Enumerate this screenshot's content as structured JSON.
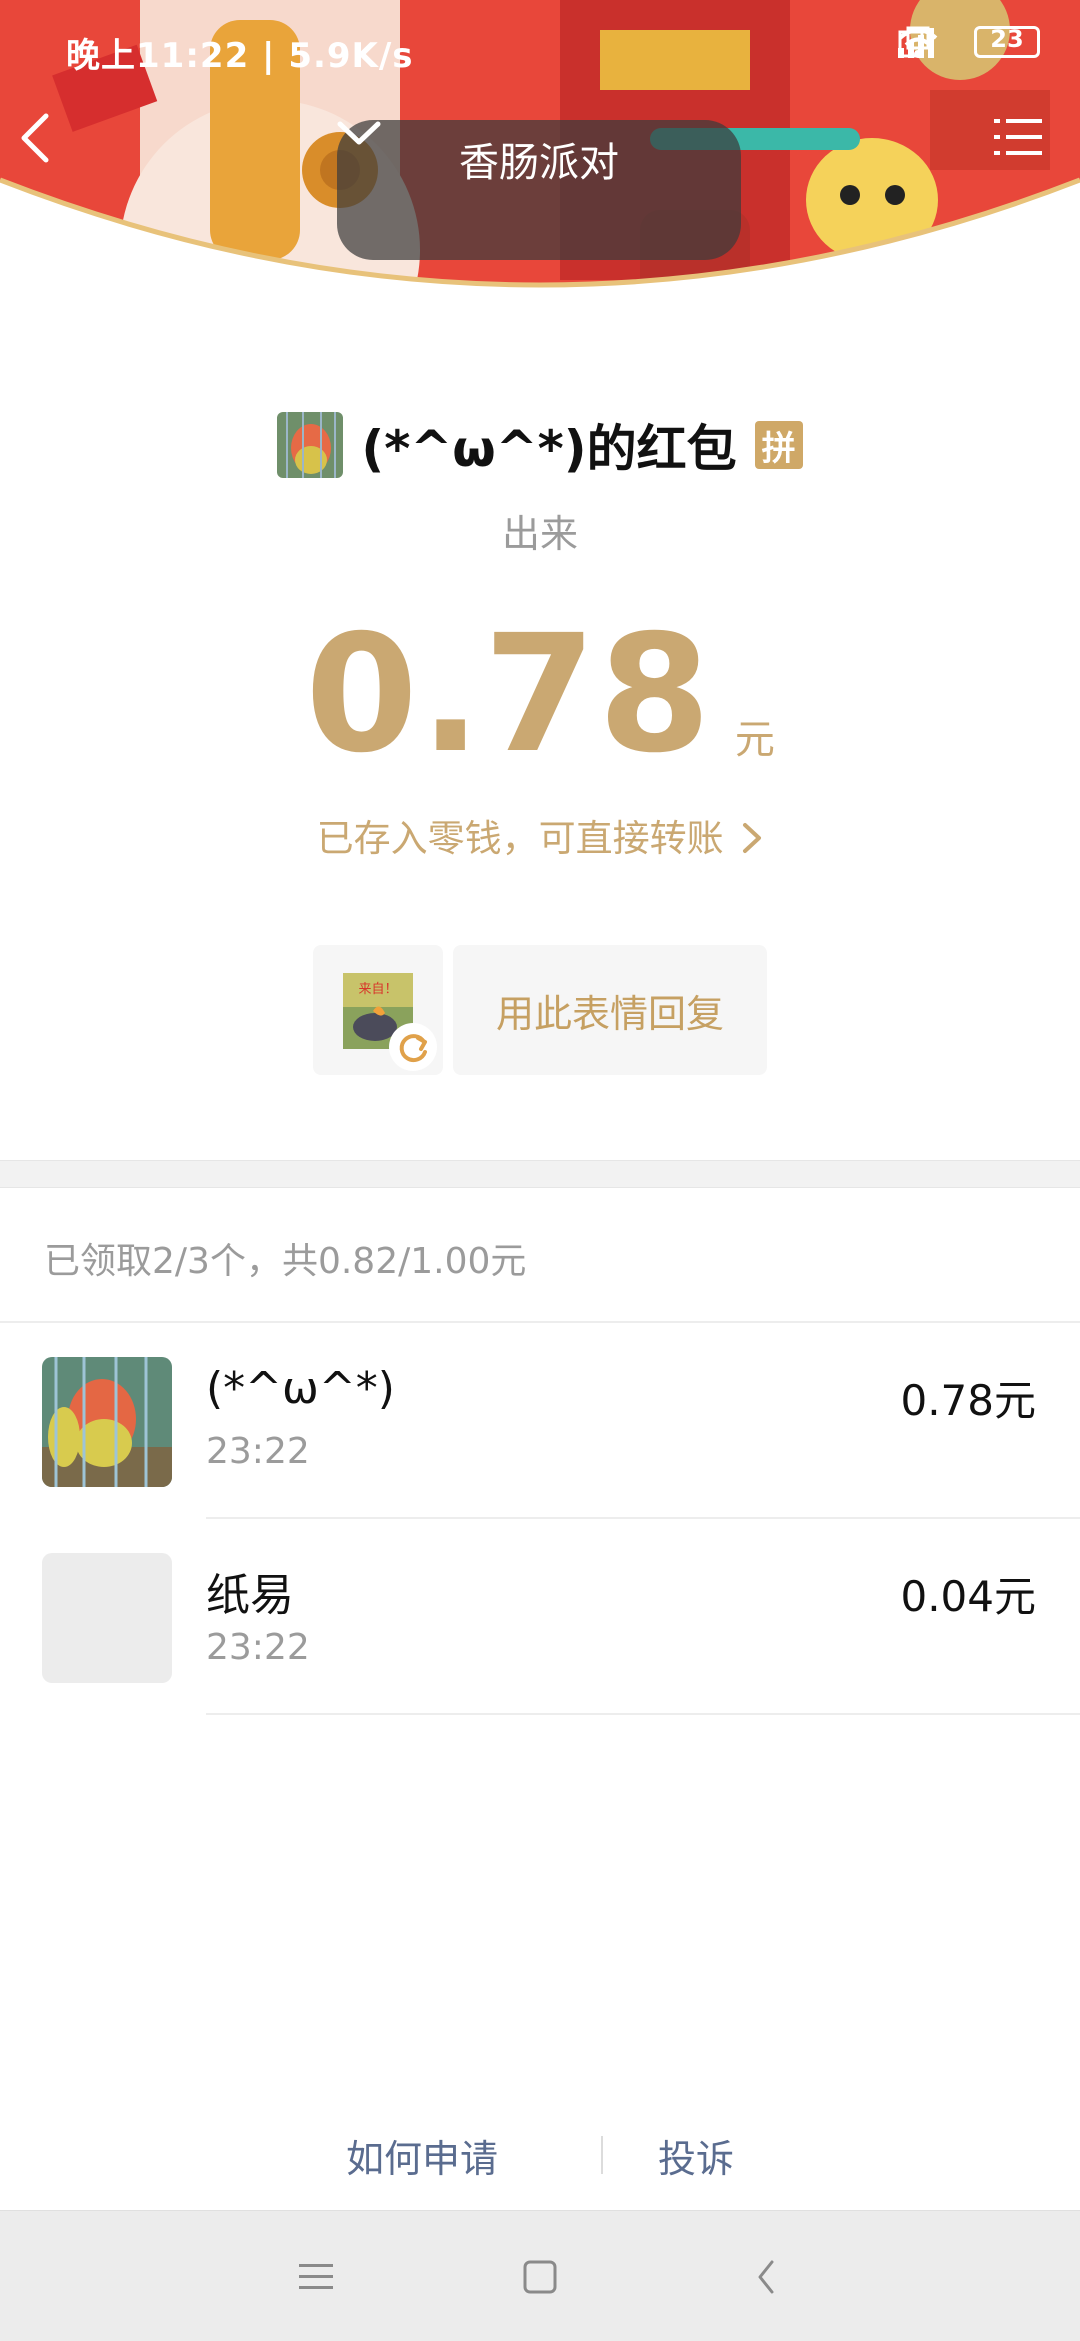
{
  "status_bar": {
    "time_text": "晚上11:22 | 5.9K/s",
    "battery": "23"
  },
  "header": {
    "title": "香肠派对",
    "banner_colors": {
      "red": "#e8473a",
      "gold": "#e9b44c",
      "pink": "#f7c9b4"
    }
  },
  "sender": {
    "name": "(*^ω^*)的红包",
    "badge": "拼",
    "greeting": "出来"
  },
  "amount": {
    "value": "0.78",
    "unit": "元",
    "wallet_note": "已存入零钱，可直接转账"
  },
  "reply": {
    "button_label": "用此表情回复",
    "sticker_text": "来自！"
  },
  "summary": {
    "text": "已领取2/3个，共0.82/1.00元"
  },
  "records": [
    {
      "name": "(*^ω^*)",
      "time": "23:22",
      "amount": "0.78元"
    },
    {
      "name": "纸易",
      "time": "23:22",
      "amount": "0.04元"
    }
  ],
  "footer": {
    "apply_label": "如何申请",
    "complain_label": "投诉"
  },
  "icons": {
    "back": "back-arrow-icon",
    "menu": "list-menu-icon",
    "chevron": "chevron-down-icon",
    "refresh": "refresh-icon",
    "wallet_chevron": "chevron-right-icon"
  },
  "colors": {
    "gold_text": "#caa872",
    "link_blue": "#5a6c8f",
    "muted_text": "#9b9b9b"
  }
}
